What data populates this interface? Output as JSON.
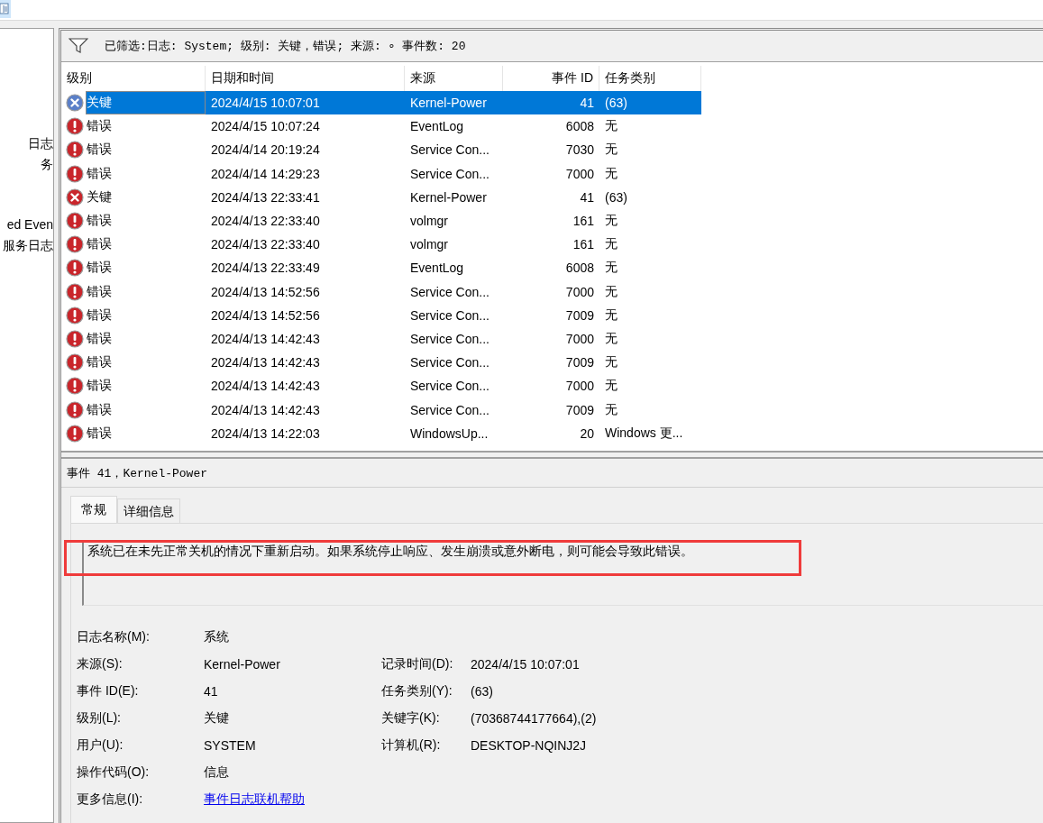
{
  "sidebar": {
    "items": [
      {
        "label": "日志"
      },
      {
        "label": "务"
      },
      {
        "label": "ed Even"
      },
      {
        "label": "服务日志"
      }
    ]
  },
  "filter": {
    "text": "已筛选:日志: System; 级别: 关键，错误; 来源: ∘ 事件数: 20"
  },
  "table": {
    "columns": [
      "级别",
      "日期和时间",
      "来源",
      "事件 ID",
      "任务类别"
    ],
    "rows": [
      {
        "kind": "critical",
        "selected": true,
        "level": "关键",
        "date": "2024/4/15 10:07:01",
        "source": "Kernel-Power",
        "id": "41",
        "task": "(63)"
      },
      {
        "kind": "error",
        "selected": false,
        "level": "错误",
        "date": "2024/4/15 10:07:24",
        "source": "EventLog",
        "id": "6008",
        "task": "无"
      },
      {
        "kind": "error",
        "selected": false,
        "level": "错误",
        "date": "2024/4/14 20:19:24",
        "source": "Service Con...",
        "id": "7030",
        "task": "无"
      },
      {
        "kind": "error",
        "selected": false,
        "level": "错误",
        "date": "2024/4/14 14:29:23",
        "source": "Service Con...",
        "id": "7000",
        "task": "无"
      },
      {
        "kind": "critical",
        "selected": false,
        "level": "关键",
        "date": "2024/4/13 22:33:41",
        "source": "Kernel-Power",
        "id": "41",
        "task": "(63)"
      },
      {
        "kind": "error",
        "selected": false,
        "level": "错误",
        "date": "2024/4/13 22:33:40",
        "source": "volmgr",
        "id": "161",
        "task": "无"
      },
      {
        "kind": "error",
        "selected": false,
        "level": "错误",
        "date": "2024/4/13 22:33:40",
        "source": "volmgr",
        "id": "161",
        "task": "无"
      },
      {
        "kind": "error",
        "selected": false,
        "level": "错误",
        "date": "2024/4/13 22:33:49",
        "source": "EventLog",
        "id": "6008",
        "task": "无"
      },
      {
        "kind": "error",
        "selected": false,
        "level": "错误",
        "date": "2024/4/13 14:52:56",
        "source": "Service Con...",
        "id": "7000",
        "task": "无"
      },
      {
        "kind": "error",
        "selected": false,
        "level": "错误",
        "date": "2024/4/13 14:52:56",
        "source": "Service Con...",
        "id": "7009",
        "task": "无"
      },
      {
        "kind": "error",
        "selected": false,
        "level": "错误",
        "date": "2024/4/13 14:42:43",
        "source": "Service Con...",
        "id": "7000",
        "task": "无"
      },
      {
        "kind": "error",
        "selected": false,
        "level": "错误",
        "date": "2024/4/13 14:42:43",
        "source": "Service Con...",
        "id": "7009",
        "task": "无"
      },
      {
        "kind": "error",
        "selected": false,
        "level": "错误",
        "date": "2024/4/13 14:42:43",
        "source": "Service Con...",
        "id": "7000",
        "task": "无"
      },
      {
        "kind": "error",
        "selected": false,
        "level": "错误",
        "date": "2024/4/13 14:42:43",
        "source": "Service Con...",
        "id": "7009",
        "task": "无"
      },
      {
        "kind": "error",
        "selected": false,
        "level": "错误",
        "date": "2024/4/13 14:22:03",
        "source": "WindowsUp...",
        "id": "20",
        "task": "Windows 更..."
      }
    ]
  },
  "detail": {
    "title": "事件 41，Kernel-Power",
    "tabs": [
      {
        "label": "常规",
        "selected": true
      },
      {
        "label": "详细信息",
        "selected": false
      }
    ],
    "description": "系统已在未先正常关机的情况下重新启动。如果系统停止响应、发生崩溃或意外断电，则可能会导致此错误。",
    "fields": [
      [
        {
          "label": "日志名称(M):",
          "value": "系统",
          "kind": "text"
        }
      ],
      [
        {
          "label": "来源(S):",
          "value": "Kernel-Power",
          "kind": "text"
        },
        {
          "label": "记录时间(D):",
          "value": "2024/4/15 10:07:01",
          "kind": "text"
        }
      ],
      [
        {
          "label": "事件 ID(E):",
          "value": "41",
          "kind": "text"
        },
        {
          "label": "任务类别(Y):",
          "value": "(63)",
          "kind": "text"
        }
      ],
      [
        {
          "label": "级别(L):",
          "value": "关键",
          "kind": "text"
        },
        {
          "label": "关键字(K):",
          "value": "(70368744177664),(2)",
          "kind": "text"
        }
      ],
      [
        {
          "label": "用户(U):",
          "value": "SYSTEM",
          "kind": "text"
        },
        {
          "label": "计算机(R):",
          "value": "DESKTOP-NQINJ2J",
          "kind": "text"
        }
      ],
      [
        {
          "label": "操作代码(O):",
          "value": "信息",
          "kind": "text"
        }
      ],
      [
        {
          "label": "更多信息(I):",
          "value": "事件日志联机帮助",
          "kind": "link"
        }
      ]
    ]
  }
}
